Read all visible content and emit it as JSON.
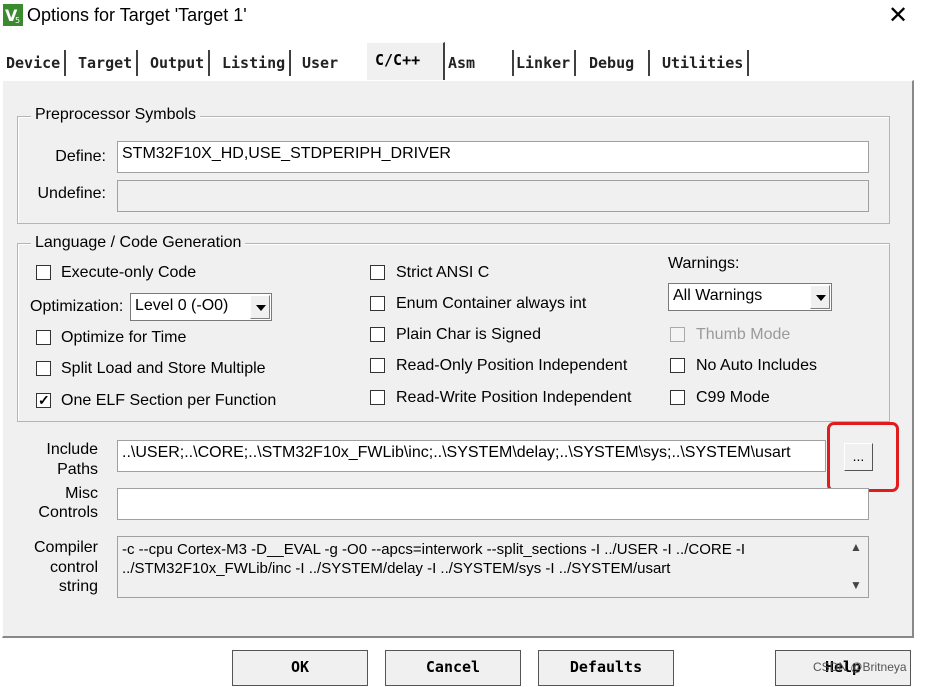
{
  "window": {
    "title": "Options for Target 'Target 1'"
  },
  "tabs": [
    "Device",
    "Target",
    "Output",
    "Listing",
    "User",
    "C/C++",
    "Asm",
    "Linker",
    "Debug",
    "Utilities"
  ],
  "active_tab": "C/C++",
  "preprocessor": {
    "group_label": "Preprocessor Symbols",
    "define_label": "Define:",
    "define_value": "STM32F10X_HD,USE_STDPERIPH_DRIVER",
    "undefine_label": "Undefine:",
    "undefine_value": ""
  },
  "codegen": {
    "group_label": "Language / Code Generation",
    "execute_only": {
      "label": "Execute-only Code",
      "checked": false
    },
    "optimization_label": "Optimization:",
    "optimization_value": "Level 0 (-O0)",
    "optimize_time": {
      "label": "Optimize for Time",
      "checked": false
    },
    "split_load": {
      "label": "Split Load and Store Multiple",
      "checked": false
    },
    "one_elf": {
      "label": "One ELF Section per Function",
      "checked": true
    },
    "strict_ansi": {
      "label": "Strict ANSI C",
      "checked": false
    },
    "enum_container": {
      "label": "Enum Container always int",
      "checked": false
    },
    "plain_char": {
      "label": "Plain Char is Signed",
      "checked": false
    },
    "ro_pos": {
      "label": "Read-Only Position Independent",
      "checked": false
    },
    "rw_pos": {
      "label": "Read-Write Position Independent",
      "checked": false
    },
    "warnings_label": "Warnings:",
    "warnings_value": "All Warnings",
    "thumb_mode": {
      "label": "Thumb Mode",
      "checked": false,
      "disabled": true
    },
    "no_auto_includes": {
      "label": "No Auto Includes",
      "checked": false
    },
    "c99_mode": {
      "label": "C99 Mode",
      "checked": false
    }
  },
  "include_paths": {
    "label_line1": "Include",
    "label_line2": "Paths",
    "value": "..\\USER;..\\CORE;..\\STM32F10x_FWLib\\inc;..\\SYSTEM\\delay;..\\SYSTEM\\sys;..\\SYSTEM\\usart",
    "browse_label": "..."
  },
  "misc_controls": {
    "label_line1": "Misc",
    "label_line2": "Controls",
    "value": ""
  },
  "compiler_string": {
    "label_line1": "Compiler",
    "label_line2": "control",
    "label_line3": "string",
    "line1": "-c --cpu Cortex-M3 -D__EVAL -g -O0 --apcs=interwork --split_sections -I ../USER -I ../CORE -I",
    "line2": "../STM32F10x_FWLib/inc -I ../SYSTEM/delay -I ../SYSTEM/sys -I ../SYSTEM/usart"
  },
  "buttons": {
    "ok": "OK",
    "cancel": "Cancel",
    "defaults": "Defaults",
    "help": "Help"
  },
  "watermark": "CSDN @Britneya",
  "colors": {
    "highlight_box": "#e01c1c",
    "dialog_bg": "#f0f0f0"
  }
}
